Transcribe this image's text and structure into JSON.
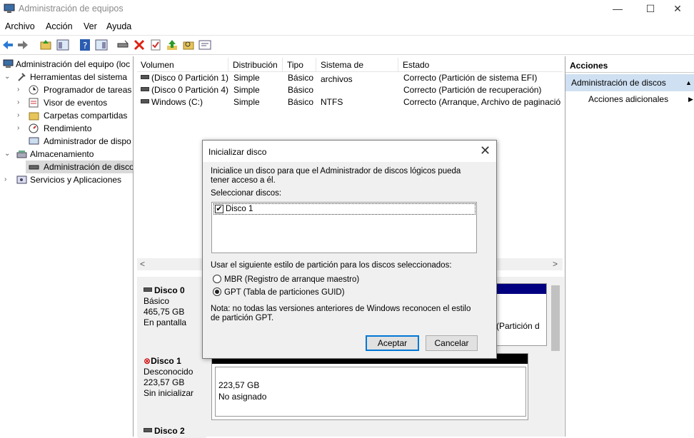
{
  "window": {
    "title": "Administración de equipos",
    "controls": [
      "—",
      "☐",
      "✕"
    ]
  },
  "menu": [
    "Archivo",
    "Acción",
    "Ver",
    "Ayuda"
  ],
  "tree": {
    "root": "Administración del equipo (loc",
    "system_tools": "Herramientas del sistema",
    "task_scheduler": "Programador de tareas",
    "event_viewer": "Visor de eventos",
    "shared_folders": "Carpetas compartidas",
    "performance": "Rendimiento",
    "device_manager": "Administrador de dispo",
    "storage": "Almacenamiento",
    "disk_management": "Administración de disco",
    "services": "Servicios y Aplicaciones"
  },
  "volumes": {
    "columns": [
      "Volumen",
      "Distribución",
      "Tipo",
      "Sistema de archivos",
      "Estado"
    ],
    "rows": [
      [
        "(Disco 0 Partición 1)",
        "Simple",
        "Básico",
        "",
        "Correcto (Partición de sistema EFI)"
      ],
      [
        "(Disco 0 Partición 4)",
        "Simple",
        "Básico",
        "",
        "Correcto (Partición de recuperación)"
      ],
      [
        "Windows (C:)",
        "Simple",
        "Básico",
        "NTFS",
        "Correcto (Arranque, Archivo de paginació"
      ]
    ]
  },
  "disks": {
    "disk0": {
      "name": "Disco 0",
      "type": "Básico",
      "size": "465,75 GB",
      "status": "En pantalla",
      "partition_hint": "(Partición d"
    },
    "disk1": {
      "name": "Disco 1",
      "type": "Desconocido",
      "size": "223,57 GB",
      "status": "Sin inicializar",
      "bar_size": "223,57 GB",
      "bar_status": "No asignado"
    },
    "disk2": {
      "name": "Disco 2"
    }
  },
  "actions": {
    "title": "Acciones",
    "selected": "Administración de discos",
    "more": "Acciones adicionales"
  },
  "dialog": {
    "title": "Inicializar disco",
    "description": "Inicialice un disco para que el Administrador de discos lógicos pueda tener acceso a él.",
    "select_label": "Seleccionar discos:",
    "disk_item": "Disco 1",
    "disk_checked": true,
    "style_label": "Usar el siguiente estilo de partición para los discos seleccionados:",
    "option_mbr": "MBR (Registro de arranque maestro)",
    "option_gpt": "GPT (Tabla de particiones GUID)",
    "selected_option": "GPT",
    "note": "Nota: no todas las versiones anteriores de Windows reconocen el estilo de partición GPT.",
    "ok": "Aceptar",
    "cancel": "Cancelar"
  },
  "colors": {
    "selection": "#cfe0f2",
    "accent": "#0078d7",
    "disk_bar": "#000080"
  }
}
